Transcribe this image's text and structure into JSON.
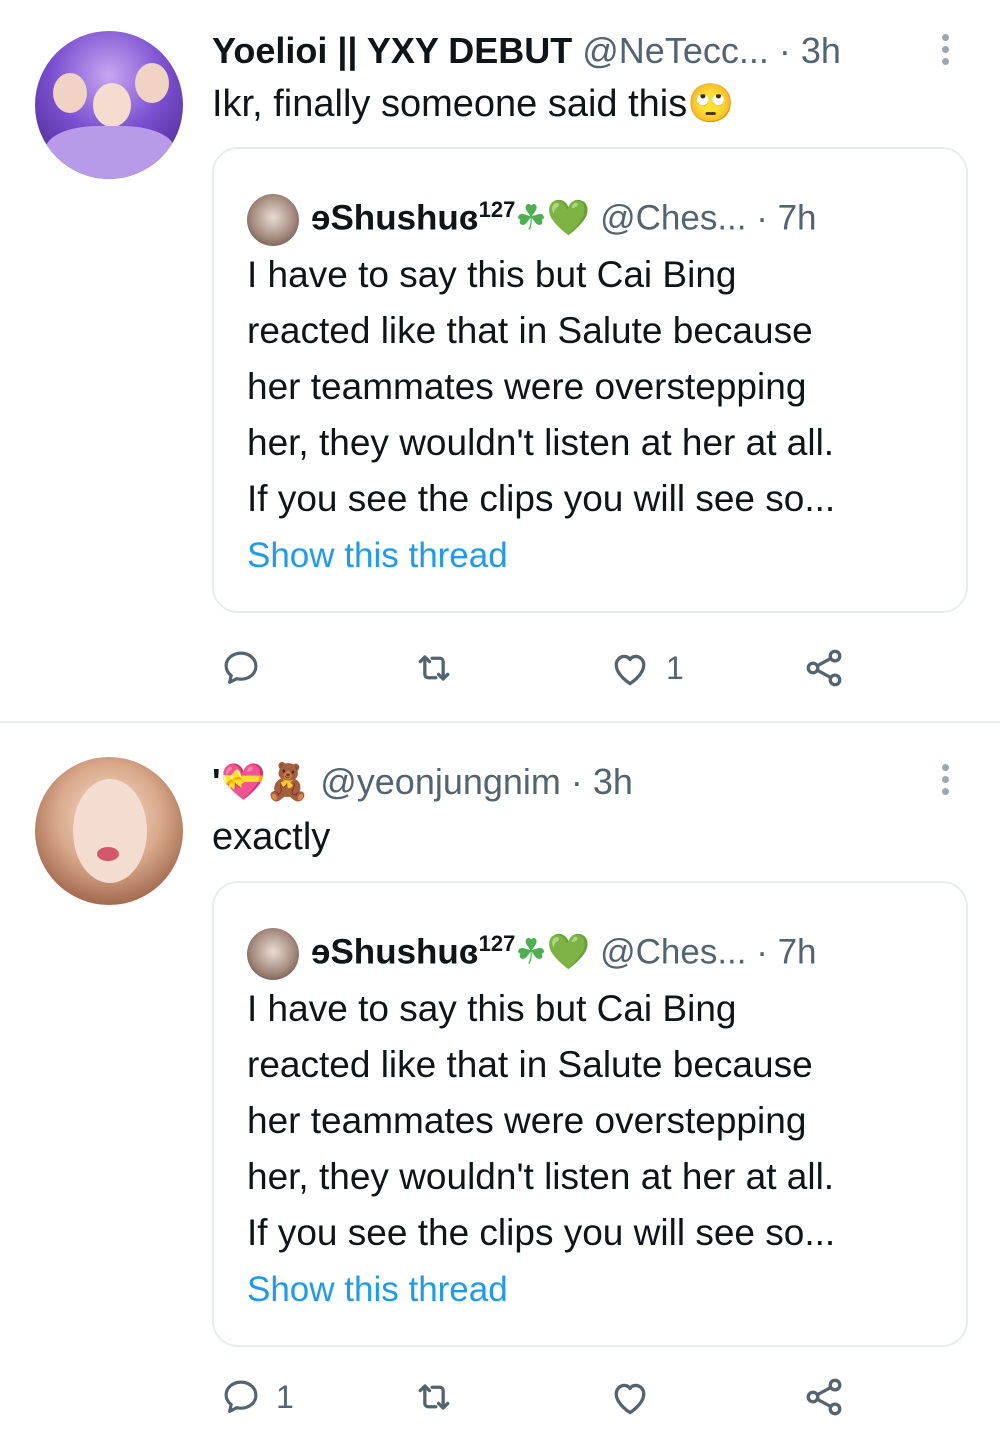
{
  "tweets": [
    {
      "display_name": "Yoelioi || YXY DEBUT",
      "handle_time": "@NeTecc... · 3h",
      "text": "Ikr, finally someone said this",
      "emoji": "🙄",
      "quote": {
        "name": "ɘShushuɞ",
        "name_suffix": "127",
        "name_emojis": "☘💚",
        "handle_time": "@Ches... · 7h",
        "lines": [
          "I have to say this but Cai Bing",
          "reacted like that in Salute because",
          "her teammates were overstepping",
          "her, they wouldn't listen at her at all.",
          "If you see the clips you will see so..."
        ],
        "link": "Show this thread"
      },
      "actions": {
        "reply_count": "",
        "retweet_count": "",
        "like_count": "1"
      }
    },
    {
      "display_name": "'💝🧸",
      "handle_time": "@yeonjungnim · 3h",
      "text": "exactly",
      "quote": {
        "name": "ɘShushuɞ",
        "name_suffix": "127",
        "name_emojis": "☘💚",
        "handle_time": "@Ches... · 7h",
        "lines": [
          "I have to say this but Cai Bing",
          "reacted like that in Salute because",
          "her teammates were overstepping",
          "her, they wouldn't listen at her at all.",
          "If you see the clips you will see so..."
        ],
        "link": "Show this thread"
      },
      "actions": {
        "reply_count": "1",
        "retweet_count": "",
        "like_count": ""
      }
    }
  ],
  "colors": {
    "link": "#1d9bf0",
    "muted": "#536471",
    "border": "#e6ecf0"
  },
  "icons": [
    "reply-icon",
    "retweet-icon",
    "like-icon",
    "share-icon",
    "more-options-icon"
  ]
}
